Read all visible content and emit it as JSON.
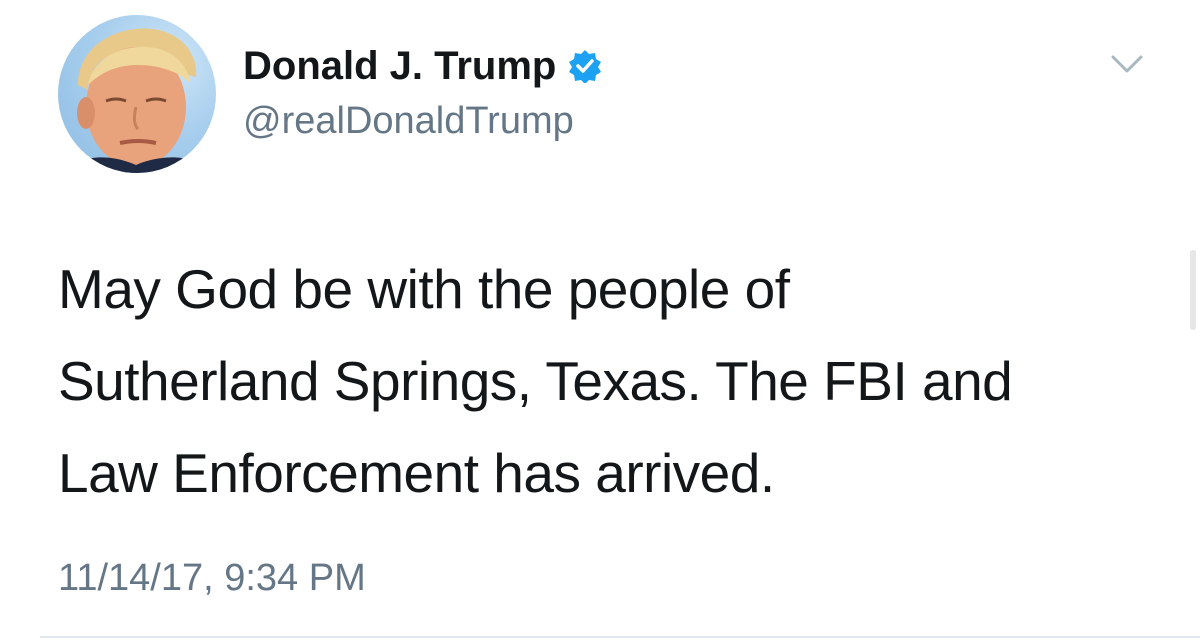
{
  "author": {
    "display_name": "Donald J. Trump",
    "handle": "@realDonaldTrump",
    "verified": true,
    "avatar_icon": "profile-photo"
  },
  "tweet": {
    "text_lines": [
      "May God be with the people of",
      "Sutherland Springs, Texas. The FBI and",
      "Law Enforcement has arrived."
    ],
    "timestamp": "11/14/17, 9:34 PM"
  },
  "icons": {
    "verified": "verified-badge-icon",
    "menu": "chevron-down-icon"
  },
  "colors": {
    "text_primary": "#14171a",
    "text_secondary": "#657786",
    "verified_blue": "#1da1f2",
    "divider": "#e1e8ed"
  }
}
